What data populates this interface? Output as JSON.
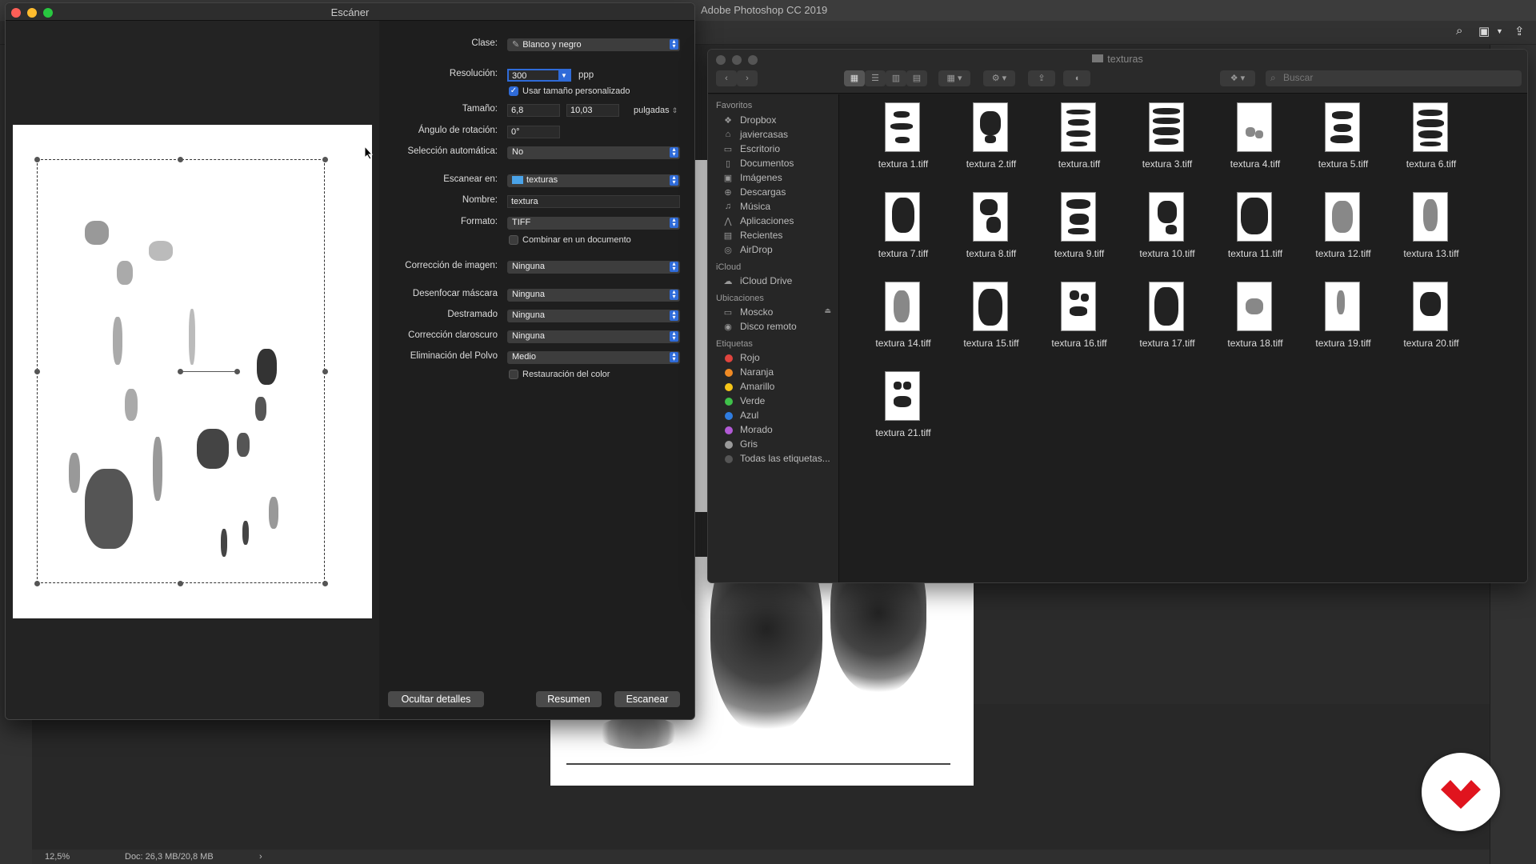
{
  "photoshop": {
    "app_title": "Adobe Photoshop CC 2019",
    "zoom": "12,5%",
    "doc_info": "Doc: 26,3 MB/20,8 MB",
    "status_arrow": "›"
  },
  "scanner": {
    "title": "Escáner",
    "fields": {
      "clase_label": "Clase:",
      "clase_value": "Blanco y negro",
      "resolucion_label": "Resolución:",
      "resolucion_value": "300",
      "resolucion_unit": "ppp",
      "custom_size_label": "Usar tamaño personalizado",
      "tamano_label": "Tamaño:",
      "tamano_w": "6,8",
      "tamano_h": "10,03",
      "tamano_unit": "pulgadas",
      "angulo_label": "Ángulo de rotación:",
      "angulo_value": "0°",
      "seleccion_label": "Selección automática:",
      "seleccion_value": "No",
      "escanear_en_label": "Escanear en:",
      "escanear_en_value": "texturas",
      "nombre_label": "Nombre:",
      "nombre_value": "textura",
      "formato_label": "Formato:",
      "formato_value": "TIFF",
      "combinar_label": "Combinar en un documento",
      "correccion_label": "Corrección de imagen:",
      "correccion_value": "Ninguna",
      "desenfocar_label": "Desenfocar máscara",
      "desenfocar_value": "Ninguna",
      "destramado_label": "Destramado",
      "destramado_value": "Ninguna",
      "claroscuro_label": "Corrección claroscuro",
      "claroscuro_value": "Ninguna",
      "polvo_label": "Eliminación del Polvo",
      "polvo_value": "Medio",
      "restauracion_label": "Restauración del color"
    },
    "buttons": {
      "hide_details": "Ocultar detalles",
      "summary": "Resumen",
      "scan": "Escanear"
    }
  },
  "finder": {
    "title": "texturas",
    "search_placeholder": "Buscar",
    "sidebar": {
      "favorites_header": "Favoritos",
      "favorites": [
        {
          "label": "Dropbox",
          "icon": "dropbox-icon"
        },
        {
          "label": "javiercasas",
          "icon": "home-icon"
        },
        {
          "label": "Escritorio",
          "icon": "desktop-icon"
        },
        {
          "label": "Documentos",
          "icon": "documents-icon"
        },
        {
          "label": "Imágenes",
          "icon": "images-icon"
        },
        {
          "label": "Descargas",
          "icon": "downloads-icon"
        },
        {
          "label": "Música",
          "icon": "music-icon"
        },
        {
          "label": "Aplicaciones",
          "icon": "applications-icon"
        },
        {
          "label": "Recientes",
          "icon": "recents-icon"
        },
        {
          "label": "AirDrop",
          "icon": "airdrop-icon"
        }
      ],
      "icloud_header": "iCloud",
      "icloud": [
        {
          "label": "iCloud Drive",
          "icon": "cloud-icon"
        }
      ],
      "locations_header": "Ubicaciones",
      "locations": [
        {
          "label": "Moscko",
          "icon": "disk-icon"
        },
        {
          "label": "Disco remoto",
          "icon": "remote-disk-icon"
        }
      ],
      "tags_header": "Etiquetas",
      "tags": [
        {
          "label": "Rojo",
          "color": "#e0443e"
        },
        {
          "label": "Naranja",
          "color": "#f08a24"
        },
        {
          "label": "Amarillo",
          "color": "#f5c518"
        },
        {
          "label": "Verde",
          "color": "#3fc14a"
        },
        {
          "label": "Azul",
          "color": "#2f7ce0"
        },
        {
          "label": "Morado",
          "color": "#b25ad6"
        },
        {
          "label": "Gris",
          "color": "#9a9a9a"
        }
      ],
      "all_tags": "Todas las etiquetas..."
    },
    "files": [
      "textura 1.tiff",
      "textura 2.tiff",
      "textura.tiff",
      "textura 3.tiff",
      "textura 4.tiff",
      "textura 5.tiff",
      "textura 6.tiff",
      "textura 7.tiff",
      "textura 8.tiff",
      "textura 9.tiff",
      "textura 10.tiff",
      "textura 11.tiff",
      "textura 12.tiff",
      "textura 13.tiff",
      "textura 14.tiff",
      "textura 15.tiff",
      "textura 16.tiff",
      "textura 17.tiff",
      "textura 18.tiff",
      "textura 19.tiff",
      "textura 20.tiff",
      "textura 21.tiff"
    ]
  }
}
